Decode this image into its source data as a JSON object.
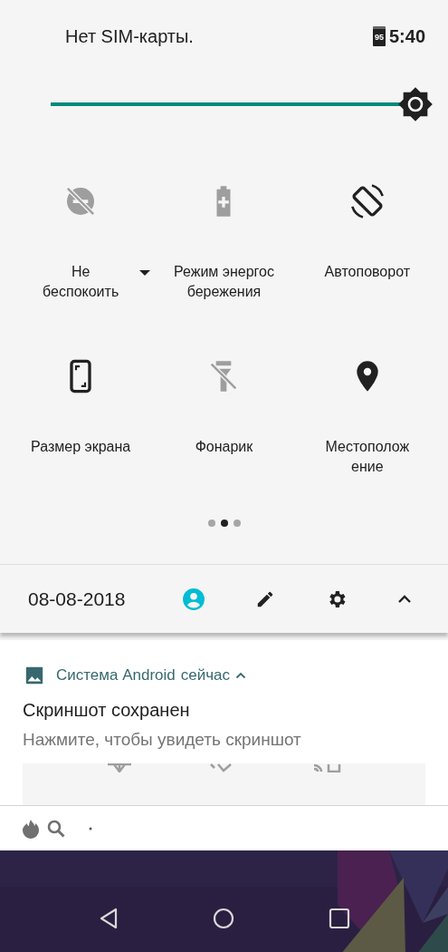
{
  "status_bar": {
    "carrier": "Нет SIM-карты.",
    "battery": "95",
    "time": "5:40"
  },
  "brightness": {
    "level": 1.0
  },
  "tiles": [
    {
      "kind": "dnd",
      "on": false,
      "lines": [
        "Не",
        "беспокоить"
      ],
      "dropdown": true
    },
    {
      "kind": "battery_saver",
      "on": false,
      "lines": [
        "Режим энергос",
        "бережения"
      ],
      "dropdown": false
    },
    {
      "kind": "rotate",
      "on": true,
      "lines": [
        "Автоповорот"
      ],
      "dropdown": false
    },
    {
      "kind": "screen_size",
      "on": true,
      "lines": [
        "Размер экрана"
      ],
      "dropdown": false
    },
    {
      "kind": "flashlight",
      "on": false,
      "lines": [
        "Фонарик"
      ],
      "dropdown": false
    },
    {
      "kind": "location",
      "on": true,
      "lines": [
        "Местополож",
        "ение"
      ],
      "dropdown": false
    }
  ],
  "pages": [
    {
      "selected": false
    },
    {
      "selected": true
    },
    {
      "selected": false
    }
  ],
  "footer": {
    "date": "08-08-2018"
  },
  "notification": {
    "app": "Система Android",
    "time": "сейчас",
    "expanded": true,
    "title": "Скриншот сохранен",
    "body": "Нажмите, чтобы увидеть скриншот"
  }
}
